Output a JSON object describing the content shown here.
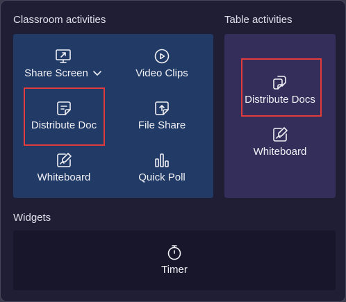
{
  "sections": {
    "classroom": {
      "title": "Classroom activities",
      "items": [
        {
          "label": "Share Screen",
          "icon": "share-screen-icon",
          "has_dropdown": true
        },
        {
          "label": "Video Clips",
          "icon": "video-clips-icon"
        },
        {
          "label": "Distribute Doc",
          "icon": "distribute-doc-icon",
          "highlighted": true
        },
        {
          "label": "File Share",
          "icon": "file-share-icon"
        },
        {
          "label": "Whiteboard",
          "icon": "whiteboard-icon"
        },
        {
          "label": "Quick Poll",
          "icon": "quick-poll-icon"
        }
      ]
    },
    "table": {
      "title": "Table activities",
      "items": [
        {
          "label": "Distribute Docs",
          "icon": "distribute-docs-icon",
          "highlighted": true
        },
        {
          "label": "Whiteboard",
          "icon": "whiteboard-icon"
        }
      ]
    },
    "widgets": {
      "title": "Widgets",
      "items": [
        {
          "label": "Timer",
          "icon": "timer-icon"
        }
      ]
    }
  },
  "colors": {
    "panel_bg": "#1f1e35",
    "classroom_card": "#213a66",
    "table_card": "#332e5a",
    "widgets_card": "#17162b",
    "highlight": "#e23b3b"
  }
}
